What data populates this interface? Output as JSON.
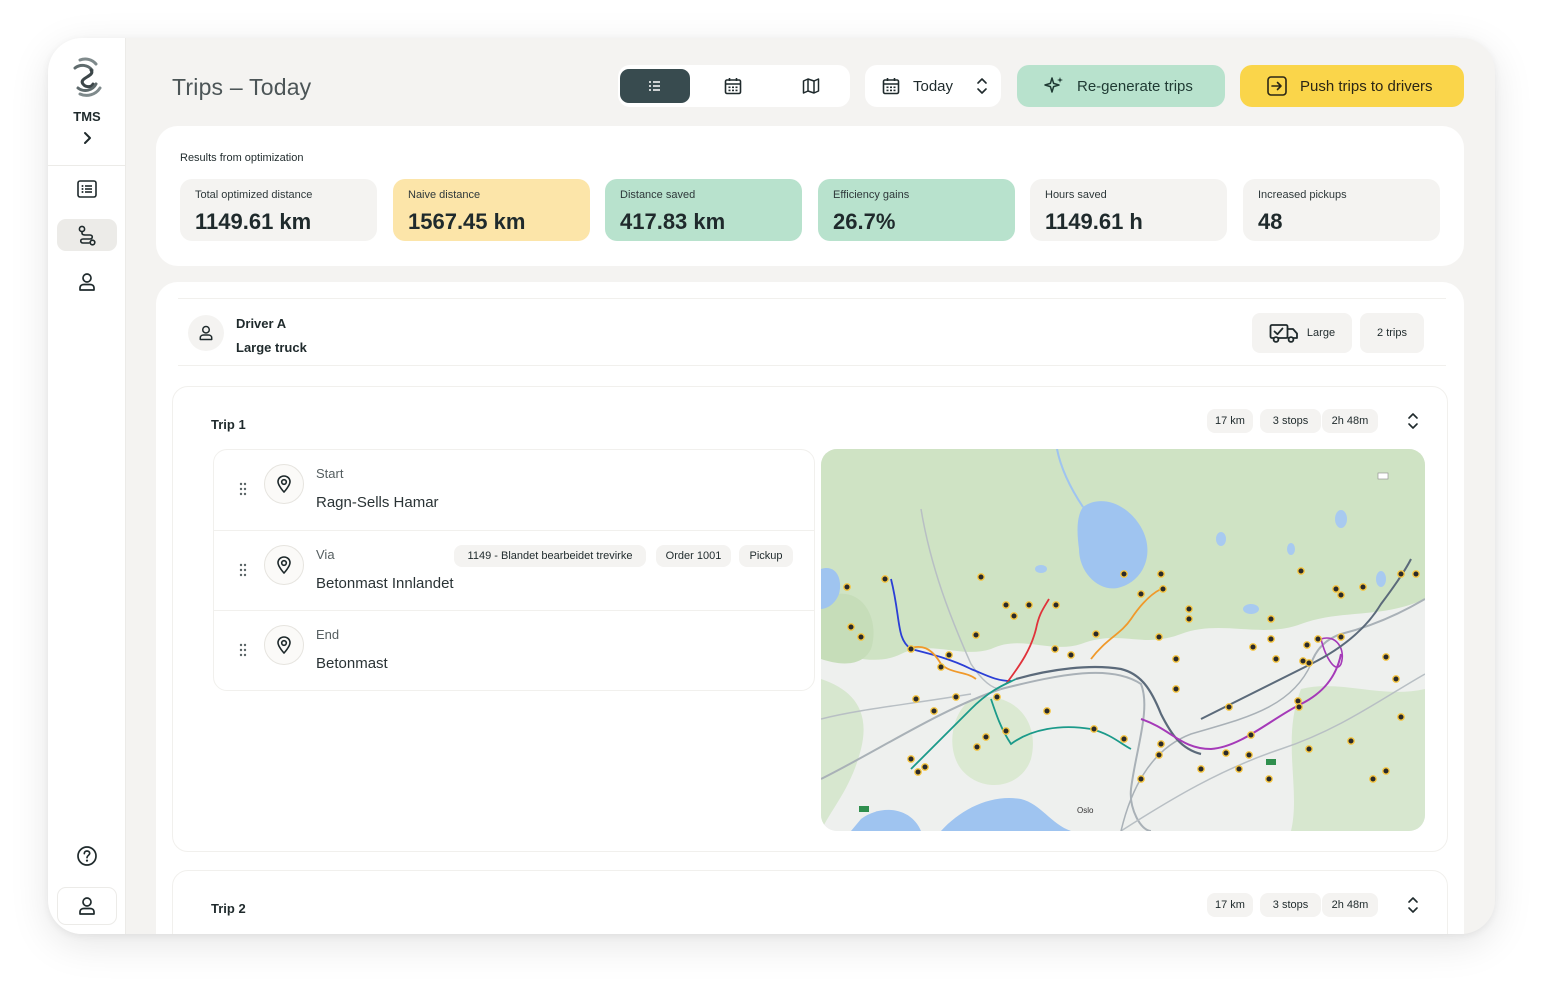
{
  "app": {
    "brand": "TMS"
  },
  "sidebar": {
    "items": [
      {
        "name": "trip-list",
        "icon": "list-icon",
        "active": false
      },
      {
        "name": "routes",
        "icon": "route-icon",
        "active": true
      },
      {
        "name": "drivers",
        "icon": "user-icon",
        "active": false
      }
    ],
    "bottom": [
      {
        "name": "help",
        "icon": "help-icon"
      },
      {
        "name": "account",
        "icon": "user-icon"
      }
    ]
  },
  "header": {
    "title": "Trips – Today",
    "views": [
      {
        "name": "list",
        "icon": "list-icon",
        "active": true
      },
      {
        "name": "calendar",
        "icon": "calendar-icon",
        "active": false
      },
      {
        "name": "map",
        "icon": "map-icon",
        "active": false
      }
    ],
    "date_selector": "Today",
    "regenerate_label": "Re-generate trips",
    "push_label": "Push trips to drivers"
  },
  "results": {
    "title": "Results from optimization",
    "stats": [
      {
        "label": "Total optimized distance",
        "value": "1149.61 km",
        "style": "neutral"
      },
      {
        "label": "Naive distance",
        "value": "1567.45 km",
        "style": "yellow"
      },
      {
        "label": "Distance saved",
        "value": "417.83 km",
        "style": "green"
      },
      {
        "label": "Efficiency gains",
        "value": "26.7%",
        "style": "green"
      },
      {
        "label": "Hours saved",
        "value": "1149.61 h",
        "style": "neutral"
      },
      {
        "label": "Increased pickups",
        "value": "48",
        "style": "neutral"
      }
    ]
  },
  "driver": {
    "name": "Driver A",
    "vehicle": "Large truck",
    "vehicle_size": "Large",
    "trip_count": "2 trips"
  },
  "trips": [
    {
      "title": "Trip 1",
      "distance": "17 km",
      "stops_count": "3 stops",
      "duration": "2h 48m",
      "stops": [
        {
          "type": "Start",
          "name": "Ragn-Sells Hamar",
          "tags": []
        },
        {
          "type": "Via",
          "name": "Betonmast Innlandet",
          "tags": [
            "1149 - Blandet bearbeidet trevirke",
            "Order 1001",
            "Pickup"
          ]
        },
        {
          "type": "End",
          "name": "Betonmast",
          "tags": []
        }
      ],
      "map_labels": [
        "Oslo"
      ]
    },
    {
      "title": "Trip 2",
      "distance": "17 km",
      "stops_count": "3 stops",
      "duration": "2h 48m"
    }
  ],
  "colors": {
    "accent_dark": "#384b4f",
    "green": "#b8e2cd",
    "yellow": "#fad54a",
    "naive_yellow": "#fce5a9",
    "route_blue": "#2b3fd6",
    "route_red": "#e0323a",
    "route_orange": "#f0992a",
    "route_teal": "#1b9a8a",
    "route_purple": "#a53ab8",
    "route_gray": "#5b6a7a"
  }
}
